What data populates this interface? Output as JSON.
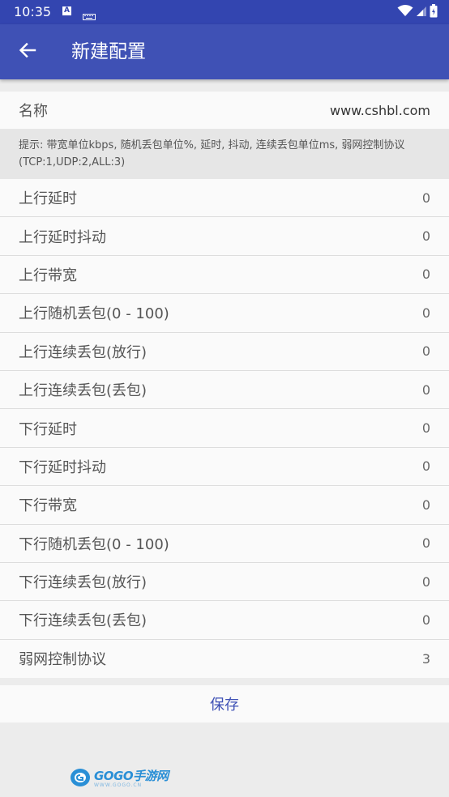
{
  "status_bar": {
    "time": "10:35",
    "a_icon_letter": "A",
    "icons": [
      "a-notification-icon",
      "keyboard-icon",
      "wifi-icon",
      "signal-icon",
      "battery-icon"
    ]
  },
  "app_bar": {
    "title": "新建配置",
    "back_icon": "arrow-back-icon",
    "color": "#3f51b5",
    "status_color": "#3345b0"
  },
  "name_row": {
    "label": "名称",
    "value": "www.cshbl.com"
  },
  "hint": {
    "text": "提示: 带宽单位kbps, 随机丢包单位%, 延时, 抖动, 连续丢包单位ms, 弱网控制协议(TCP:1,UDP:2,ALL:3)"
  },
  "settings": [
    {
      "label": "上行延时",
      "value": "0"
    },
    {
      "label": "上行延时抖动",
      "value": "0"
    },
    {
      "label": "上行带宽",
      "value": "0"
    },
    {
      "label": "上行随机丢包(0 - 100)",
      "value": "0"
    },
    {
      "label": "上行连续丢包(放行)",
      "value": "0"
    },
    {
      "label": "上行连续丢包(丢包)",
      "value": "0"
    },
    {
      "label": "下行延时",
      "value": "0"
    },
    {
      "label": "下行延时抖动",
      "value": "0"
    },
    {
      "label": "下行带宽",
      "value": "0"
    },
    {
      "label": "下行随机丢包(0 - 100)",
      "value": "0"
    },
    {
      "label": "下行连续丢包(放行)",
      "value": "0"
    },
    {
      "label": "下行连续丢包(丢包)",
      "value": "0"
    },
    {
      "label": "弱网控制协议",
      "value": "3"
    }
  ],
  "save": {
    "label": "保存",
    "color": "#3f51b5"
  },
  "watermark": {
    "text": "GOGO手游网",
    "sub": "WWW.GOGO.CN"
  }
}
